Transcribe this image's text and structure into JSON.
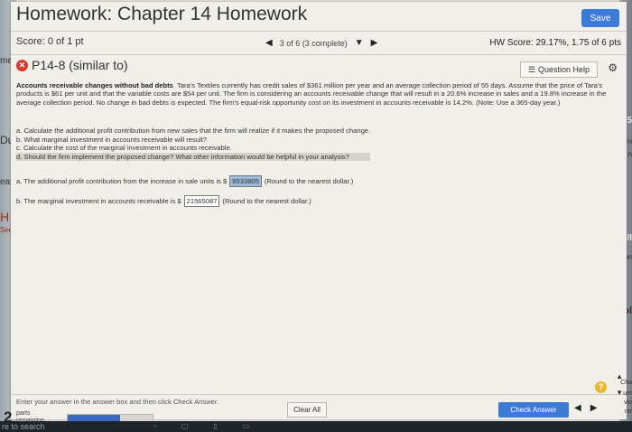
{
  "window": {
    "title": "Homework: Chapter 14 Homework",
    "save_label": "Save",
    "score": "Score: 0 of 1 pt",
    "nav": {
      "prev": "◀",
      "position": "3 of 6 (3 complete)",
      "dropdown": "▼",
      "next": "▶"
    },
    "hw_score": "HW Score: 29.17%, 1.75 of 6 pts",
    "problem": {
      "status_icon": "incorrect-x-icon",
      "title": "P14-8 (similar to)"
    },
    "question_help": {
      "icon": "list-icon",
      "label": "Question Help"
    },
    "gear": "⚙"
  },
  "question": {
    "heading": "Accounts receivable changes without bad debts",
    "text": "Tara's Textiles currently has credit sales of $361 million per year and an average collection period of 55 days. Assume that the price of Tara's products is $61 per unit and that the variable costs are $54 per unit. The firm is considering an accounts receivable change that will result in a 20.6% increase in sales and a 19.8% increase in the average collection period. No change in bad debts is expected. The firm's equal-risk opportunity cost on its investment in accounts receivable is 14.2%. (Note: Use a 365-day year.)",
    "items": [
      "a. Calculate the additional profit contribution from new sales that the firm will realize if it makes the proposed change.",
      "b. What marginal investment in accounts receivable will result?",
      "c. Calculate the cost of the marginal investment in accounts receivable.",
      "d. Should the firm implement the proposed change? What other information would be helpful in your analysis?"
    ],
    "answer_a": {
      "prefix": "a. The additional profit contribution from the increase in sale units is $",
      "value": "8533805",
      "suffix": "(Round to the nearest dollar.)"
    },
    "answer_b": {
      "prefix": "b. The marginal investment in accounts receivable is $",
      "value": "21565087",
      "suffix": "(Round to the nearest dollar.)"
    }
  },
  "footer": {
    "instruction": "Enter your answer in the answer box and then click Check Answer.",
    "parts_count": "2",
    "parts_label_1": "parts",
    "parts_label_2": "remaining",
    "progress_fraction": 0.62,
    "clear_label": "Clear All",
    "check_label": "Check Answer",
    "prev": "◀",
    "next": "▶",
    "help": "?"
  },
  "background": {
    "left_fragments": [
      "me",
      "Du",
      "eas",
      "H",
      "Sec"
    ],
    "right_fragments": [
      "5",
      "ro",
      "n",
      "UI",
      "on",
      "ol",
      "Cha",
      "um",
      "vio",
      "ntr"
    ]
  },
  "taskbar": {
    "search": "re to search"
  },
  "colors": {
    "accent": "#3d7ad6",
    "error": "#d73b2f",
    "help": "#e9b82e"
  }
}
